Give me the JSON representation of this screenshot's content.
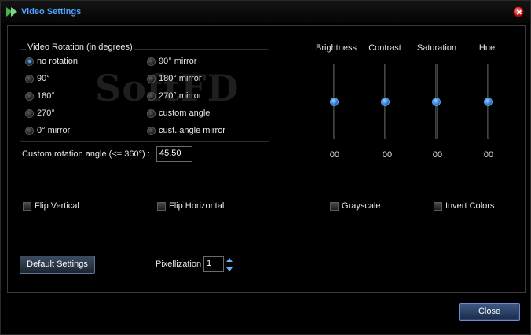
{
  "window": {
    "title": "Video Settings"
  },
  "rotation": {
    "group_label": "Video Rotation (in degrees)",
    "watermark": "SoftFD",
    "options": [
      {
        "label": "no rotation",
        "selected": true
      },
      {
        "label": "90°",
        "selected": false
      },
      {
        "label": "180°",
        "selected": false
      },
      {
        "label": "270°",
        "selected": false
      },
      {
        "label": "0° mirror",
        "selected": false
      },
      {
        "label": "90° mirror",
        "selected": false
      },
      {
        "label": "180° mirror",
        "selected": false
      },
      {
        "label": "270° mirror",
        "selected": false
      },
      {
        "label": "custom angle",
        "selected": false
      },
      {
        "label": "cust. angle mirror",
        "selected": false
      }
    ],
    "custom_angle_label": "Custom rotation angle (<= 360°) :",
    "custom_angle_value": "45,50"
  },
  "sliders": [
    {
      "label": "Brightness",
      "value": "00",
      "level": 0.5
    },
    {
      "label": "Contrast",
      "value": "00",
      "level": 0.5
    },
    {
      "label": "Saturation",
      "value": "00",
      "level": 0.5
    },
    {
      "label": "Hue",
      "value": "00",
      "level": 0.5
    }
  ],
  "checkboxes": [
    {
      "label": "Flip Vertical",
      "checked": false
    },
    {
      "label": "Flip Horizontal",
      "checked": false
    },
    {
      "label": "Grayscale",
      "checked": false
    },
    {
      "label": "Invert Colors",
      "checked": false
    }
  ],
  "footer": {
    "default_button": "Default Settings",
    "pixelization_label": "Pixellization",
    "pixelization_value": "1",
    "close_button": "Close"
  },
  "colors": {
    "accent": "#4ea2ff",
    "background": "#000000"
  }
}
